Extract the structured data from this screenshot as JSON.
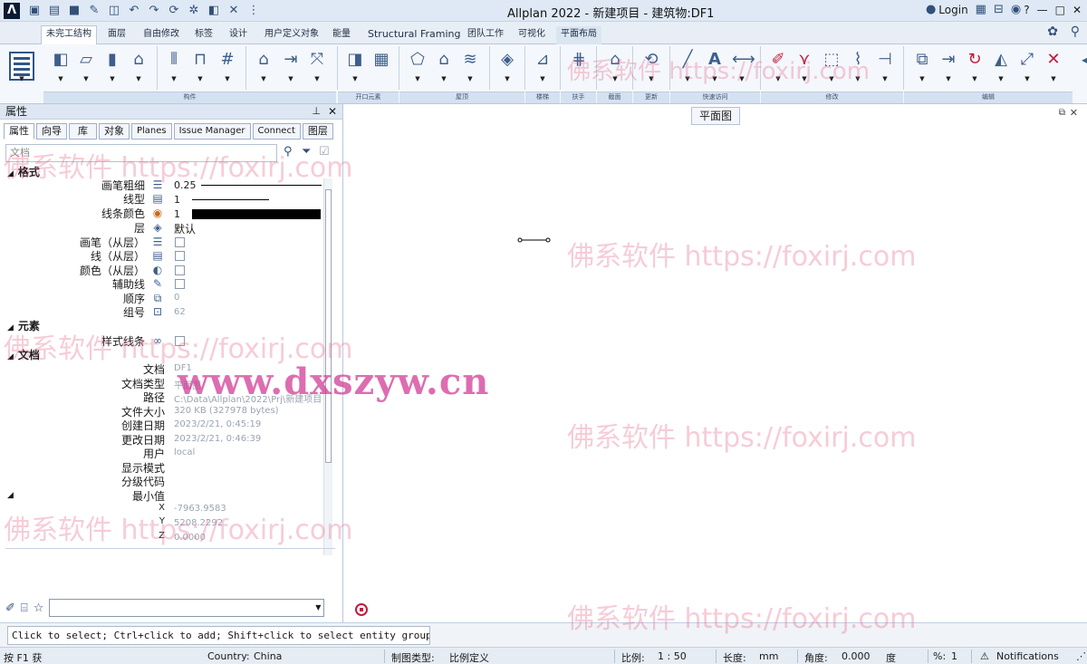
{
  "titlebar": {
    "app_title": "Allplan 2022 - 新建项目 - 建筑物:DF1",
    "login_label": "Login",
    "help_label": "?"
  },
  "ribbon": {
    "tabs": [
      {
        "label": "未完工结构"
      },
      {
        "label": "面层"
      },
      {
        "label": "自由修改"
      },
      {
        "label": "标签"
      },
      {
        "label": "设计"
      },
      {
        "label": "用户定义对象"
      },
      {
        "label": "能量"
      },
      {
        "label": "Structural Framing"
      },
      {
        "label": "团队工作"
      },
      {
        "label": "可视化"
      },
      {
        "label": "平面布局"
      }
    ],
    "groups": [
      {
        "label": "构件"
      },
      {
        "label": "开口元素"
      },
      {
        "label": "屋顶"
      },
      {
        "label": "楼梯"
      },
      {
        "label": "扶手"
      },
      {
        "label": "截面"
      },
      {
        "label": "更新"
      },
      {
        "label": "快速访问"
      },
      {
        "label": "修改"
      },
      {
        "label": "编辑"
      }
    ]
  },
  "panel": {
    "title": "属性",
    "tabs": [
      {
        "label": "属性"
      },
      {
        "label": "向导"
      },
      {
        "label": "库"
      },
      {
        "label": "对象"
      },
      {
        "label": "Planes"
      },
      {
        "label": "Issue Manager"
      },
      {
        "label": "Connect"
      },
      {
        "label": "图层"
      }
    ],
    "search_placeholder": "文档",
    "sections": {
      "format": "格式",
      "element": "元素",
      "document": "文档"
    },
    "format_rows": {
      "pen_label": "画笔粗细",
      "pen_value": "0.25",
      "linetype_label": "线型",
      "linetype_value": "1",
      "color_label": "线条颜色",
      "color_value": "1",
      "layer_label": "层",
      "layer_value": "默认",
      "pen_from_layer": "画笔（从层）",
      "line_from_layer": "线（从层）",
      "color_from_layer": "颜色（从层）",
      "construction_line": "辅助线",
      "order_label": "顺序",
      "order_value": "0",
      "group_label": "组号",
      "group_value": "62"
    },
    "element_rows": {
      "style_line": "样式线条"
    },
    "document_rows": {
      "doc_label": "文档",
      "doc_value": "DF1",
      "doctype_label": "文档类型",
      "doctype_value": "平面图",
      "path_label": "路径",
      "path_value": "C:\\Data\\Allplan\\2022\\Prj\\新建项目",
      "size_label": "文件大小",
      "size_value": "320 KB (327978 bytes)",
      "created_label": "创建日期",
      "created_value": "2023/2/21, 0:45:19",
      "modified_label": "更改日期",
      "modified_value": "2023/2/21, 0:46:39",
      "user_label": "用户",
      "user_value": "local",
      "display_label": "显示模式",
      "classification_label": "分级代码",
      "min_label": "最小值",
      "x_label": "X",
      "x_value": "-7963.9583",
      "y_label": "Y",
      "y_value": "5208.2292",
      "z_label": "Z",
      "z_value": "0.0000"
    }
  },
  "canvas": {
    "view_label": "平面图"
  },
  "command_line": "Click to select; Ctrl+click to add; Shift+click to select entity group",
  "status": {
    "help": "按 F1 获",
    "country_label": "Country:",
    "country_value": "China",
    "drawing_type_label": "制图类型:",
    "drawing_type_value": "比例定义",
    "scale_label": "比例:",
    "scale_value": "1 : 50",
    "length_label": "长度:",
    "length_value": "mm",
    "angle_label": "角度:",
    "angle_value": "0.000",
    "angle_unit": "度",
    "percent_label": "%:",
    "percent_value": "1",
    "notifications": "Notifications"
  },
  "watermarks": {
    "foxirj": "佛系软件 https://foxirj.com",
    "dxszyw": "www.dxszyw.cn"
  },
  "colors": {
    "accent": "#32507a",
    "watermark_pink": "#e66e8c",
    "watermark_magenta": "#d23c96"
  }
}
